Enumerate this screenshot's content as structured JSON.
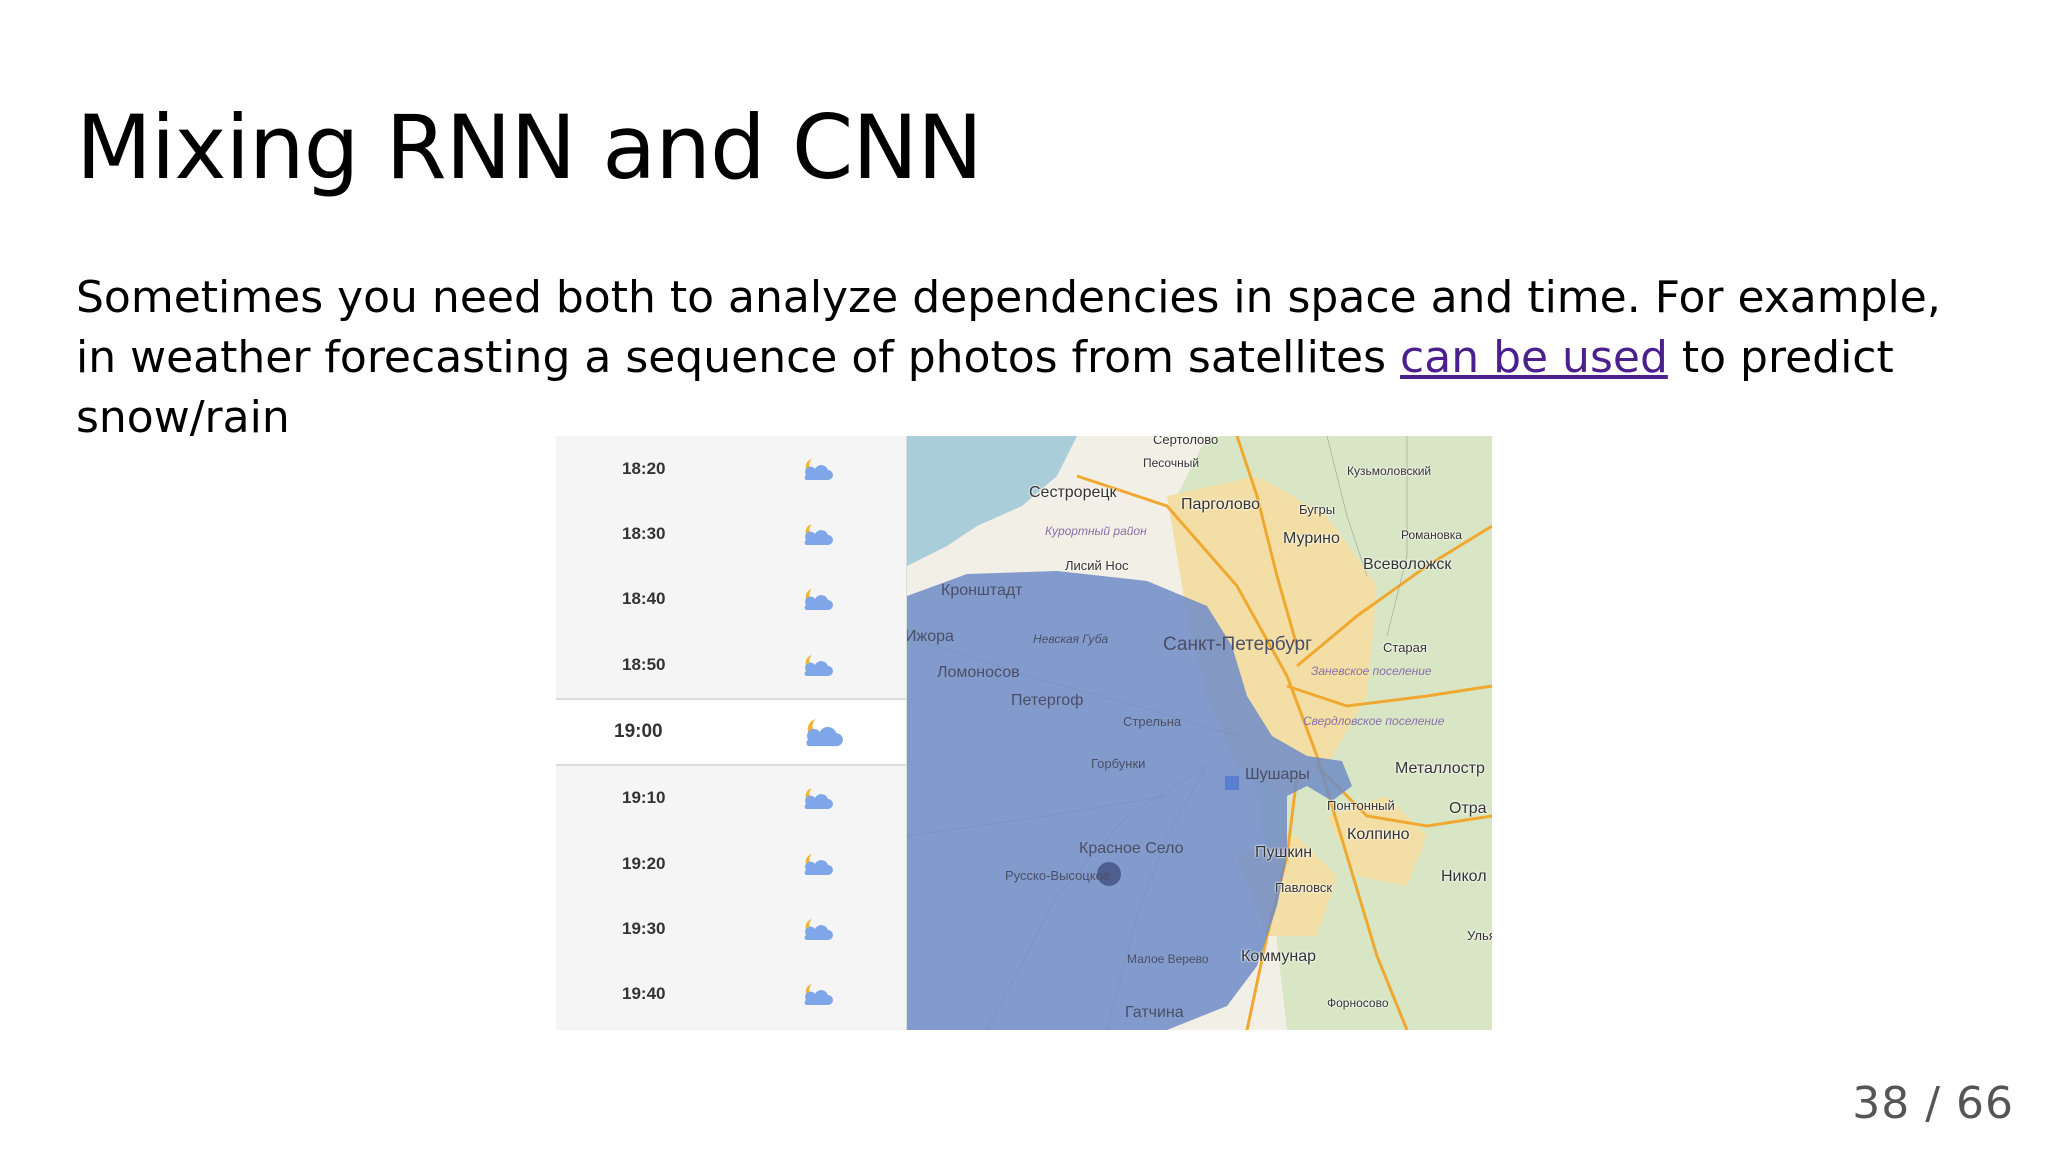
{
  "slide": {
    "title": "Mixing RNN and CNN",
    "text_before_link": "Sometimes you need both to analyze dependencies in space and time. For example, in weather forecasting a sequence of photos from satellites ",
    "link_text": "can be used",
    "text_after_link": " to predict snow/rain"
  },
  "forecast": {
    "times": [
      "18:20",
      "18:30",
      "18:40",
      "18:50",
      "19:00",
      "19:10",
      "19:20",
      "19:30",
      "19:40"
    ],
    "active_time": "19:00",
    "icon": "moon-cloud-icon"
  },
  "map": {
    "labels": [
      "Сертолово",
      "Песочный",
      "Кузьмоловский",
      "Сестрорецк",
      "Парголово",
      "Бугры",
      "Курортный район",
      "Мурино",
      "Романовка",
      "Лисий Нос",
      "Всеволожск",
      "Кронштадт",
      "Невская Губа",
      "Ижора",
      "Санкт-Петербург",
      "Старая",
      "Ломоносов",
      "Заневское поселение",
      "Петергоф",
      "Свердловское поселение",
      "Стрельна",
      "Горбунки",
      "Шушары",
      "Металлостр",
      "Понтонный",
      "Отра",
      "Колпино",
      "Красное Село",
      "Пушкин",
      "Русско-Высоцкое",
      "Никол",
      "Павловск",
      "Ульян",
      "Малое Верево",
      "Коммунар",
      "Гатчина",
      "Форносово"
    ],
    "colors": {
      "sea": "#a9cdd9",
      "land": "#f2efe6",
      "urban": "#f3dfa6",
      "forest": "#cfe3b8",
      "road": "#f0a830",
      "precip": "#6f8cc7"
    }
  },
  "footer": {
    "page_number": "38 / 66"
  }
}
